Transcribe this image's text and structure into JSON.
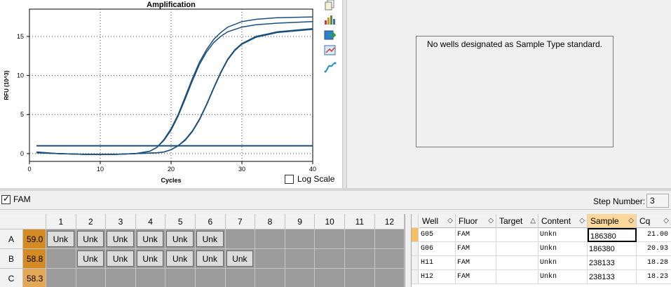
{
  "chart": {
    "title": "Amplification",
    "ylabel": "RFU (10^3)",
    "xlabel": "Cycles",
    "log_scale_label": "Log Scale",
    "log_scale_checked": false
  },
  "chart_data": {
    "type": "line",
    "title": "Amplification",
    "xlabel": "Cycles",
    "ylabel": "RFU (10^3)",
    "xlim": [
      0,
      40
    ],
    "ylim": [
      -1,
      18.5
    ],
    "xticks": [
      0,
      10,
      20,
      30,
      40
    ],
    "yticks": [
      0,
      5,
      10,
      15
    ],
    "grid": true,
    "threshold": 1.0,
    "series": [
      {
        "x": [
          1,
          4,
          8,
          12,
          15,
          17,
          18,
          19,
          20,
          21,
          22,
          23,
          24,
          25,
          26,
          27,
          28,
          30,
          32,
          35,
          40
        ],
        "values": [
          0.1,
          0.0,
          -0.1,
          -0.1,
          0.0,
          0.3,
          0.8,
          1.8,
          3.2,
          5.0,
          7.3,
          9.6,
          11.7,
          13.3,
          14.6,
          15.5,
          16.2,
          16.9,
          17.2,
          17.4,
          17.5
        ]
      },
      {
        "x": [
          1,
          4,
          8,
          12,
          15,
          17,
          18,
          19,
          20,
          21,
          22,
          23,
          24,
          25,
          26,
          27,
          28,
          30,
          32,
          35,
          40
        ],
        "values": [
          0.2,
          0.0,
          -0.1,
          -0.1,
          0.0,
          0.3,
          0.8,
          1.7,
          3.0,
          4.8,
          7.0,
          9.3,
          11.4,
          13.0,
          14.2,
          15.0,
          15.6,
          16.2,
          16.5,
          16.7,
          16.9
        ]
      },
      {
        "x": [
          1,
          4,
          8,
          12,
          15,
          18,
          19,
          20,
          21,
          22,
          23,
          24,
          25,
          26,
          27,
          28,
          29,
          30,
          32,
          35,
          40
        ],
        "values": [
          0.1,
          0.0,
          -0.1,
          -0.1,
          0.0,
          0.1,
          0.2,
          0.5,
          1.0,
          1.7,
          2.8,
          4.3,
          6.2,
          8.3,
          10.3,
          12.0,
          13.2,
          14.0,
          14.9,
          15.5,
          15.9
        ]
      },
      {
        "x": [
          1,
          4,
          8,
          12,
          15,
          18,
          19,
          20,
          21,
          22,
          23,
          24,
          25,
          26,
          27,
          28,
          29,
          30,
          32,
          35,
          40
        ],
        "values": [
          0.2,
          0.0,
          -0.1,
          -0.1,
          0.0,
          0.1,
          0.2,
          0.5,
          1.0,
          1.8,
          2.9,
          4.4,
          6.3,
          8.4,
          10.4,
          12.1,
          13.3,
          14.1,
          15.0,
          15.6,
          16.0
        ]
      }
    ]
  },
  "tools": [
    "copy-icon",
    "chart-properties-icon",
    "export-icon",
    "zoom-icon",
    "curve-icon"
  ],
  "standard_panel": {
    "message": "No wells designated as Sample Type standard."
  },
  "fluor_filter": {
    "label": "FAM",
    "checked": true
  },
  "step": {
    "label": "Step Number:",
    "value": "3"
  },
  "plate": {
    "columns": [
      "1",
      "2",
      "3",
      "4",
      "5",
      "6",
      "7",
      "8",
      "9",
      "10",
      "11",
      "12"
    ],
    "rows": [
      {
        "label": "A",
        "temp": "59.0",
        "wells": [
          "Unk",
          "Unk",
          "Unk",
          "Unk",
          "Unk",
          "Unk",
          "",
          "",
          "",
          "",
          "",
          ""
        ]
      },
      {
        "label": "B",
        "temp": "58.8",
        "wells": [
          "",
          "Unk",
          "Unk",
          "Unk",
          "Unk",
          "Unk",
          "Unk",
          "",
          "",
          "",
          "",
          ""
        ]
      },
      {
        "label": "C",
        "temp": "58.3",
        "wells": [
          "",
          "",
          "",
          "",
          "",
          "",
          "",
          "",
          "",
          "",
          "",
          ""
        ]
      }
    ]
  },
  "results": {
    "columns": [
      "Well",
      "Fluor",
      "Target",
      "Content",
      "Sample",
      "Cq"
    ],
    "rows": [
      {
        "Well": "G05",
        "Fluor": "FAM",
        "Target": "",
        "Content": "Unkn",
        "Sample": "186380",
        "Cq": "21.00"
      },
      {
        "Well": "G06",
        "Fluor": "FAM",
        "Target": "",
        "Content": "Unkn",
        "Sample": "186380",
        "Cq": "20.93"
      },
      {
        "Well": "H11",
        "Fluor": "FAM",
        "Target": "",
        "Content": "Unkn",
        "Sample": "238133",
        "Cq": "18.28"
      },
      {
        "Well": "H12",
        "Fluor": "FAM",
        "Target": "",
        "Content": "Unkn",
        "Sample": "238133",
        "Cq": "18.23"
      }
    ]
  },
  "colors": {
    "curve": "#1b4f7a",
    "temp_hot": "#d48b24",
    "temp_cool": "#e4a756",
    "selected_header": "#fbd79a"
  }
}
